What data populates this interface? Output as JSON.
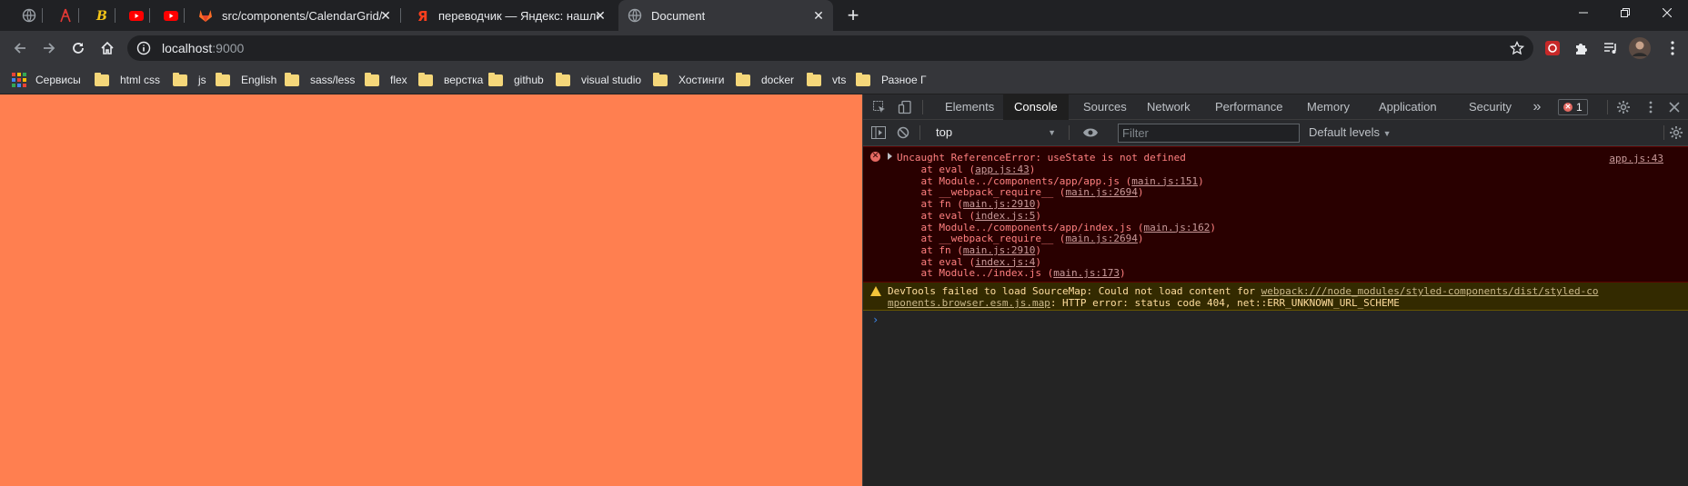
{
  "tabs": [
    {
      "title": ""
    },
    {
      "title": ""
    },
    {
      "title": ""
    },
    {
      "title": ""
    },
    {
      "title": ""
    },
    {
      "title": "src/components/CalendarGrid/index.js"
    },
    {
      "title": "переводчик — Яндекс: нашлось"
    },
    {
      "title": "Document"
    }
  ],
  "toolbar": {
    "url_host": "localhost",
    "url_port": ":9000"
  },
  "bookmarks": {
    "apps_label": "Сервисы",
    "items": [
      "html css",
      "js",
      "English",
      "sass/less",
      "flex",
      "верстка",
      "github",
      "visual studio",
      "Хостинги",
      "docker",
      "vts",
      "Разное Г"
    ]
  },
  "devtools": {
    "tabs": [
      "Elements",
      "Console",
      "Sources",
      "Network",
      "Performance",
      "Memory",
      "Application",
      "Security"
    ],
    "error_count": "1",
    "context": "top",
    "filter_placeholder": "Filter",
    "levels": "Default levels"
  },
  "console": {
    "error": {
      "message": "Uncaught ReferenceError: useState is not defined",
      "source": "app.js:43",
      "stack": [
        {
          "pre": "    at eval (",
          "link": "app.js:43",
          "post": ")"
        },
        {
          "pre": "    at Module../components/app/app.js (",
          "link": "main.js:151",
          "post": ")"
        },
        {
          "pre": "    at __webpack_require__ (",
          "link": "main.js:2694",
          "post": ")"
        },
        {
          "pre": "    at fn (",
          "link": "main.js:2910",
          "post": ")"
        },
        {
          "pre": "    at eval (",
          "link": "index.js:5",
          "post": ")"
        },
        {
          "pre": "    at Module../components/app/index.js (",
          "link": "main.js:162",
          "post": ")"
        },
        {
          "pre": "    at __webpack_require__ (",
          "link": "main.js:2694",
          "post": ")"
        },
        {
          "pre": "    at fn (",
          "link": "main.js:2910",
          "post": ")"
        },
        {
          "pre": "    at eval (",
          "link": "index.js:4",
          "post": ")"
        },
        {
          "pre": "    at Module../index.js (",
          "link": "main.js:173",
          "post": ")"
        }
      ]
    },
    "warning": {
      "pre": "DevTools failed to load SourceMap: Could not load content for ",
      "link1": "webpack:///node_modules/styled-components/dist/styled-co",
      "link2": "mponents.browser.esm.js.map",
      "post": ": HTTP error: status code 404, net::ERR_UNKNOWN_URL_SCHEME"
    },
    "prompt": "›"
  },
  "colors": {
    "page_background": "#ff7f50",
    "error_bg": "#290000",
    "error_text": "#ff8080",
    "warn_bg": "#332a00",
    "warn_text": "#ffdd9e"
  }
}
